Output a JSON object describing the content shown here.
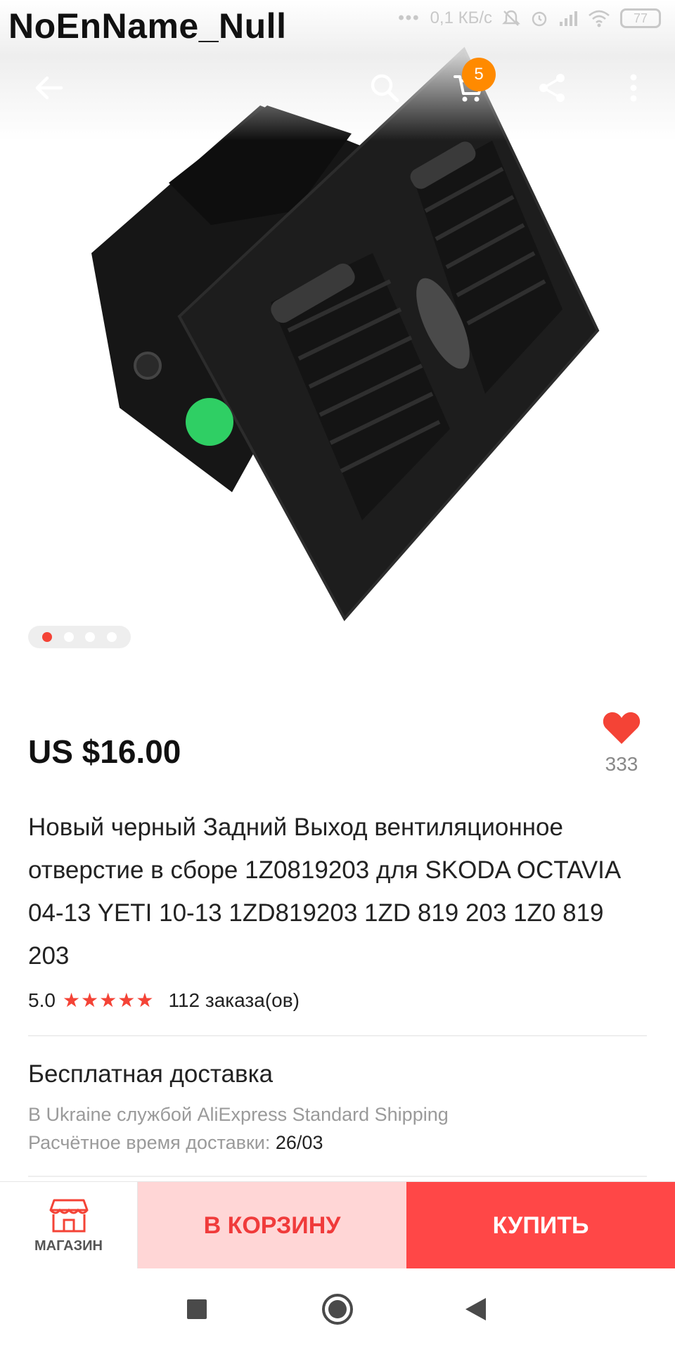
{
  "status_bar": {
    "watermark": "NoEnName_Null",
    "network_speed": "0,1 КБ/с",
    "battery": "77"
  },
  "toolbar": {
    "cart_count": "5",
    "icons": [
      "back-arrow-icon",
      "search-icon",
      "cart-icon",
      "share-icon",
      "more-vert-icon"
    ]
  },
  "gallery": {
    "image_count": 4,
    "active_index": 0
  },
  "product": {
    "price": "US $16.00",
    "wishlist_count": "333",
    "title": "Новый черный Задний Выход вентиляционное отверстие в сборе 1Z0819203 для SKODA OCTAVIA 04-13 YETI 10-13 1ZD819203 1ZD 819 203 1Z0 819 203",
    "rating": "5.0",
    "stars": "★★★★★",
    "orders": "112 заказа(ов)"
  },
  "shipping": {
    "title": "Бесплатная доставка",
    "method": "В Ukraine службой AliExpress Standard Shipping",
    "eta_label": "Расчётное время доставки:",
    "eta_value": "26/03"
  },
  "actions": {
    "shop_label": "МАГАЗИН",
    "add_to_cart": "В КОРЗИНУ",
    "buy": "КУПИТЬ"
  },
  "colors": {
    "accent": "#ff4747",
    "accent_light": "#ffd6d6",
    "badge": "#ff8a00",
    "star": "#f44336"
  }
}
